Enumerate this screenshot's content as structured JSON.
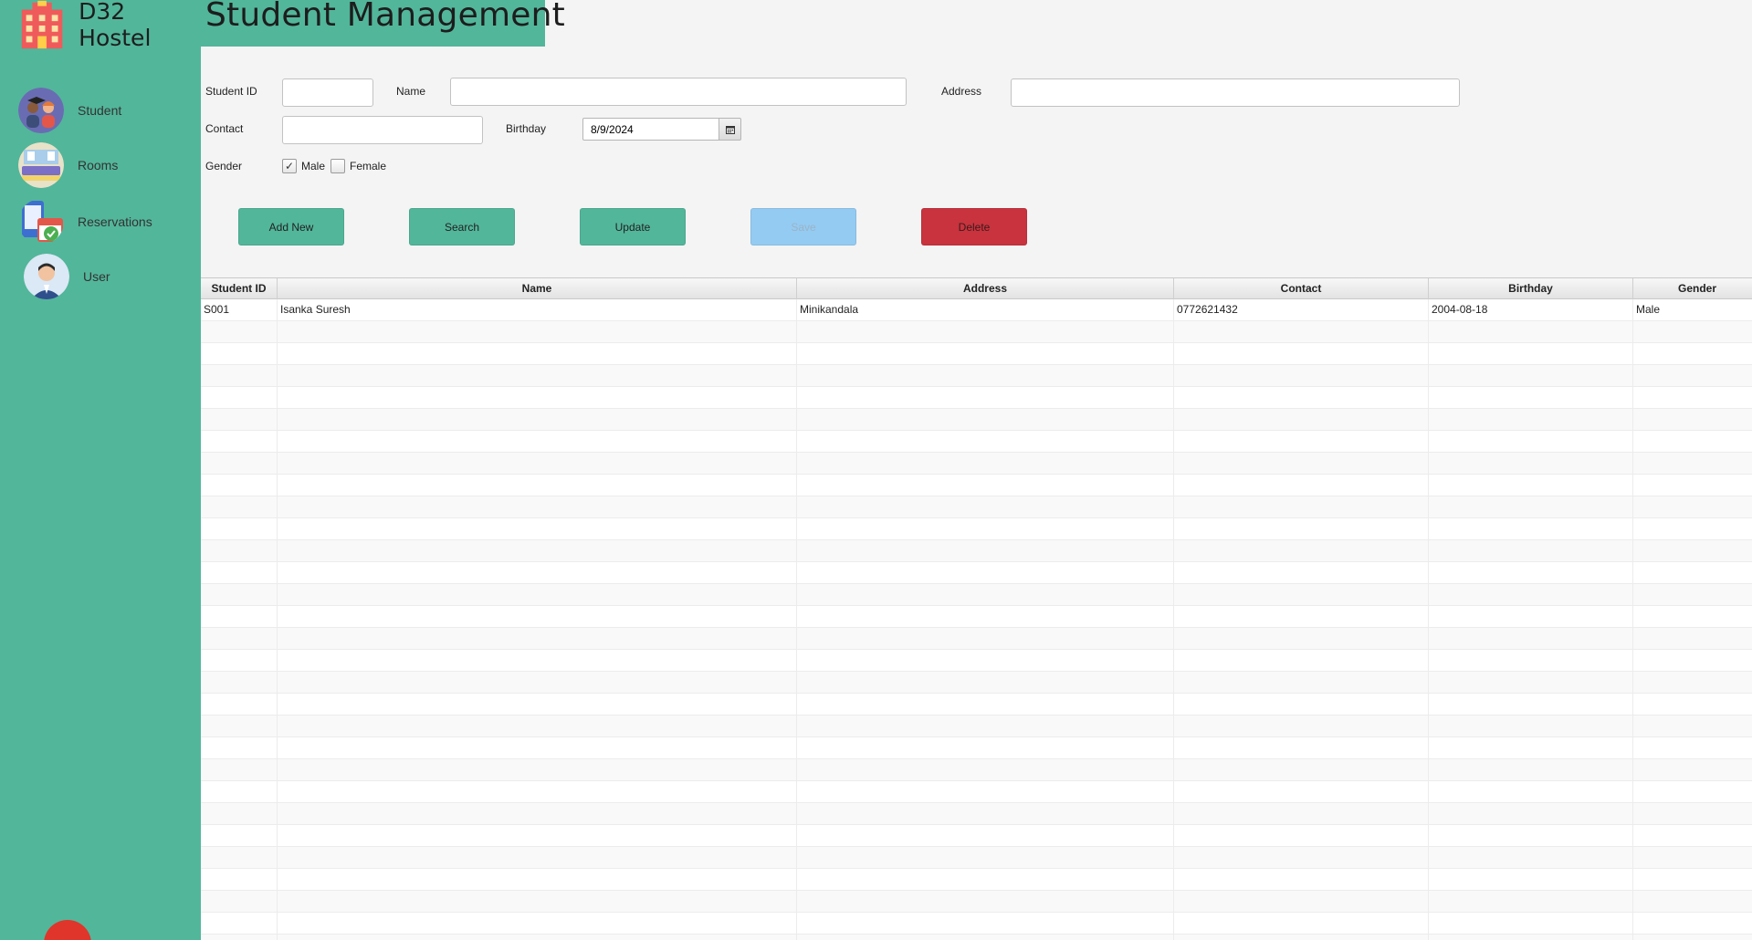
{
  "app": {
    "brand": "D32 Hostel",
    "page_title": "Student Management"
  },
  "colors": {
    "sidebar": "#52b69a",
    "button": "#52b69a",
    "save_disabled": "#94cbf2",
    "delete": "#c8333e"
  },
  "sidebar": {
    "items": [
      {
        "label": "Student",
        "icon": "students-icon"
      },
      {
        "label": "Rooms",
        "icon": "room-icon"
      },
      {
        "label": "Reservations",
        "icon": "reservations-icon"
      },
      {
        "label": "User",
        "icon": "user-avatar-icon"
      }
    ],
    "logout_icon": "logout-icon"
  },
  "form": {
    "student_id_label": "Student ID",
    "student_id_value": "",
    "name_label": "Name",
    "name_value": "",
    "address_label": "Address",
    "address_value": "",
    "contact_label": "Contact",
    "contact_value": "",
    "birthday_label": "Birthday",
    "birthday_value": "8/9/2024",
    "gender_label": "Gender",
    "male_label": "Male",
    "male_checked": true,
    "female_label": "Female",
    "female_checked": false
  },
  "buttons": {
    "add_new": "Add New",
    "search": "Search",
    "update": "Update",
    "save": "Save",
    "delete": "Delete"
  },
  "table": {
    "columns": [
      "Student ID",
      "Name",
      "Address",
      "Contact",
      "Birthday",
      "Gender"
    ],
    "rows": [
      [
        "S001",
        "Isanka Suresh",
        "Minikandala",
        "0772621432",
        "2004-08-18",
        "Male"
      ]
    ]
  }
}
